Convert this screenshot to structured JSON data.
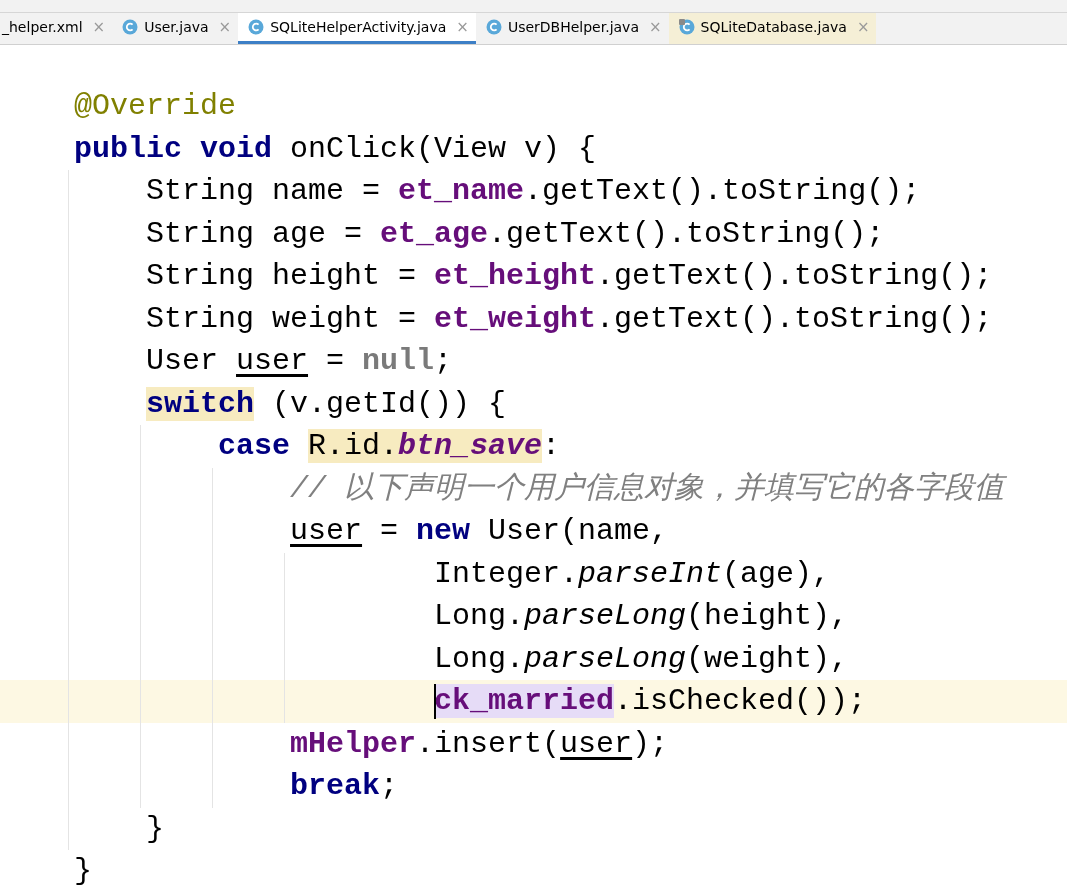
{
  "tabs": [
    {
      "label": "_helper.xml",
      "kind": "partial",
      "selected": false,
      "library": false,
      "close": "×"
    },
    {
      "label": "User.java",
      "kind": "class",
      "selected": false,
      "library": false,
      "close": "×"
    },
    {
      "label": "SQLiteHelperActivity.java",
      "kind": "class",
      "selected": true,
      "library": false,
      "close": "×"
    },
    {
      "label": "UserDBHelper.java",
      "kind": "class",
      "selected": false,
      "library": false,
      "close": "×"
    },
    {
      "label": "SQLiteDatabase.java",
      "kind": "class",
      "selected": false,
      "library": true,
      "close": "×"
    }
  ],
  "lines": [
    {
      "kind": "statement",
      "current": false,
      "tokens": [
        {
          "text": "@Override",
          "kind": "annotation"
        }
      ]
    },
    {
      "kind": "statement",
      "current": false,
      "tokens": [
        {
          "text": "public void",
          "kind": "keyword"
        },
        {
          "text": " onClick(View v) {",
          "kind": "plain"
        }
      ],
      "children": [
        {
          "kind": "statement",
          "current": false,
          "tokens": [
            {
              "text": "String name = ",
              "kind": "plain"
            },
            {
              "text": "et_name",
              "kind": "field"
            },
            {
              "text": ".getText().toString();",
              "kind": "plain"
            }
          ]
        },
        {
          "kind": "statement",
          "current": false,
          "tokens": [
            {
              "text": "String age = ",
              "kind": "plain"
            },
            {
              "text": "et_age",
              "kind": "field"
            },
            {
              "text": ".getText().toString();",
              "kind": "plain"
            }
          ]
        },
        {
          "kind": "statement",
          "current": false,
          "tokens": [
            {
              "text": "String height = ",
              "kind": "plain"
            },
            {
              "text": "et_height",
              "kind": "field"
            },
            {
              "text": ".getText().toString();",
              "kind": "plain"
            }
          ]
        },
        {
          "kind": "statement",
          "current": false,
          "tokens": [
            {
              "text": "String weight = ",
              "kind": "plain"
            },
            {
              "text": "et_weight",
              "kind": "field"
            },
            {
              "text": ".getText().toString();",
              "kind": "plain"
            }
          ]
        },
        {
          "kind": "statement",
          "current": false,
          "tokens": [
            {
              "text": "User ",
              "kind": "plain"
            },
            {
              "text": "user",
              "kind": "reassigned"
            },
            {
              "text": " = ",
              "kind": "plain"
            },
            {
              "text": "null",
              "kind": "literal"
            },
            {
              "text": ";",
              "kind": "plain"
            }
          ]
        },
        {
          "kind": "statement",
          "current": false,
          "tokens": [
            {
              "text": "switch",
              "kind": "keyword",
              "usage_highlighted": true
            },
            {
              "text": " (v.getId()) {",
              "kind": "plain"
            }
          ],
          "children": [
            {
              "kind": "statement",
              "current": false,
              "tokens": [
                {
                  "text": "case ",
                  "kind": "keyword"
                },
                {
                  "text": "R.id.",
                  "kind": "plain",
                  "usage_highlighted": true
                },
                {
                  "text": "btn_save",
                  "kind": "static-field",
                  "usage_highlighted": true
                },
                {
                  "text": ":",
                  "kind": "plain"
                }
              ],
              "children": [
                {
                  "kind": "statement",
                  "current": false,
                  "tokens": [
                    {
                      "text": "// 以下声明一个用户信息对象，并填写它的各字段值",
                      "kind": "comment"
                    }
                  ]
                },
                {
                  "kind": "statement",
                  "current": false,
                  "tokens": [
                    {
                      "text": "user",
                      "kind": "reassigned"
                    },
                    {
                      "text": " = ",
                      "kind": "plain"
                    },
                    {
                      "text": "new",
                      "kind": "keyword"
                    },
                    {
                      "text": " User(name,",
                      "kind": "plain"
                    }
                  ],
                  "children": [
                    {
                      "kind": "continuation",
                      "current": false,
                      "tokens": [
                        {
                          "text": "Integer.",
                          "kind": "plain"
                        },
                        {
                          "text": "parseInt",
                          "kind": "static-method"
                        },
                        {
                          "text": "(age),",
                          "kind": "plain"
                        }
                      ]
                    },
                    {
                      "kind": "continuation",
                      "current": false,
                      "tokens": [
                        {
                          "text": "Long.",
                          "kind": "plain"
                        },
                        {
                          "text": "parseLong",
                          "kind": "static-method"
                        },
                        {
                          "text": "(height),",
                          "kind": "plain"
                        }
                      ]
                    },
                    {
                      "kind": "continuation",
                      "current": false,
                      "tokens": [
                        {
                          "text": "Long.",
                          "kind": "plain"
                        },
                        {
                          "text": "parseLong",
                          "kind": "static-method"
                        },
                        {
                          "text": "(weight),",
                          "kind": "plain"
                        }
                      ]
                    },
                    {
                      "kind": "continuation",
                      "current": true,
                      "tokens": [
                        {
                          "text": "ck_married",
                          "kind": "field",
                          "selected": true,
                          "caret": true
                        },
                        {
                          "text": ".isChecked());",
                          "kind": "plain"
                        }
                      ]
                    }
                  ]
                },
                {
                  "kind": "statement",
                  "current": false,
                  "tokens": [
                    {
                      "text": "mHelper",
                      "kind": "field"
                    },
                    {
                      "text": ".insert(",
                      "kind": "plain"
                    },
                    {
                      "text": "user",
                      "kind": "reassigned"
                    },
                    {
                      "text": ");",
                      "kind": "plain"
                    }
                  ]
                },
                {
                  "kind": "statement",
                  "current": false,
                  "tokens": [
                    {
                      "text": "break",
                      "kind": "keyword"
                    },
                    {
                      "text": ";",
                      "kind": "plain"
                    }
                  ]
                }
              ]
            }
          ]
        },
        {
          "kind": "statement",
          "current": false,
          "tokens": [
            {
              "text": "}",
              "kind": "plain"
            }
          ]
        }
      ]
    },
    {
      "kind": "statement",
      "current": false,
      "tokens": [
        {
          "text": "}",
          "kind": "plain"
        }
      ]
    }
  ]
}
